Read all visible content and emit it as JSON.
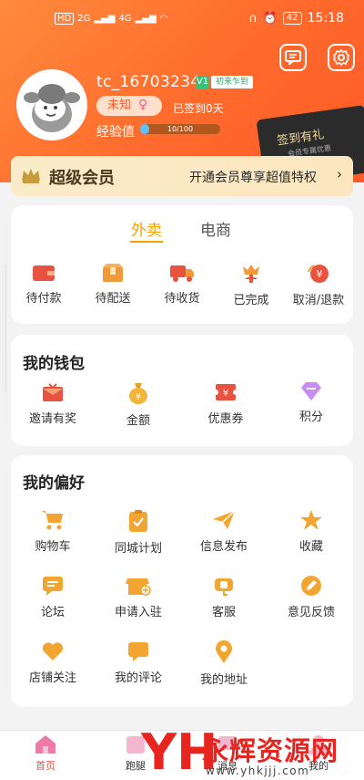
{
  "status_bar": {
    "left_icons": [
      "HD",
      "2G",
      "4G"
    ],
    "battery": "42",
    "time": "15:18"
  },
  "profile": {
    "username": "tc_16703234",
    "v_badge": "V1",
    "level_badge": "初来乍到",
    "gender": "未知",
    "signin": "已签到0天",
    "exp_label": "经验值",
    "exp_text": "10/100",
    "exp_fraction": 0.1,
    "sign_card_title": "签到有礼",
    "sign_card_sub": "会员专属优惠"
  },
  "vip": {
    "title": "超级会员",
    "cta": "开通会员尊享超值特权",
    "arrow": "›"
  },
  "orders": {
    "tabs": [
      "外卖",
      "电商"
    ],
    "items": [
      "待付款",
      "待配送",
      "待收货",
      "已完成",
      "取消/退款"
    ]
  },
  "wallet": {
    "title": "我的钱包",
    "items": [
      "邀请有奖",
      "金额",
      "优惠券",
      "积分"
    ]
  },
  "prefs": {
    "title": "我的偏好",
    "items": [
      "购物车",
      "同城计划",
      "信息发布",
      "收藏",
      "论坛",
      "申请入驻",
      "客服",
      "意见反馈",
      "店铺关注",
      "我的评论",
      "我的地址"
    ]
  },
  "nav": {
    "items": [
      "首页",
      "跑腿",
      "消息",
      "我的"
    ]
  },
  "watermark": {
    "logo": "YH",
    "title": "永辉资源网",
    "url": "www.yhkjjj.com"
  },
  "colors": {
    "header": "#ff6a2c",
    "accent": "#f5a200",
    "icon_orange": "#f3a532",
    "icon_red": "#e8533f"
  }
}
